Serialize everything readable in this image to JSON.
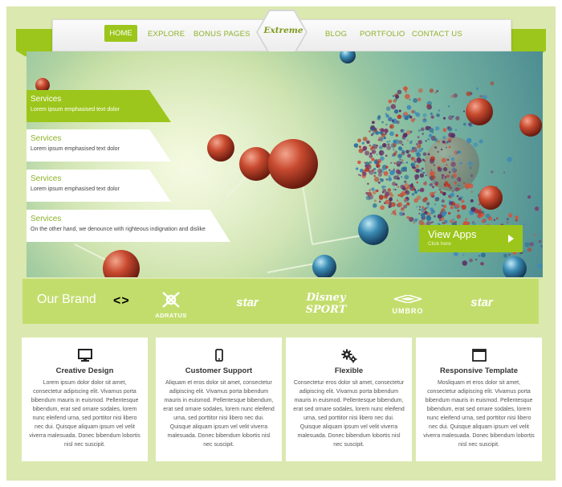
{
  "nav": {
    "home": "HOME",
    "items": [
      "EXPLORE",
      "BONUS PAGES",
      "BLOG",
      "PORTFOLIO",
      "CONTACT US"
    ],
    "logo": "Extreme"
  },
  "hero": {
    "tabs": [
      {
        "title": "Services",
        "text": "Lorem ipsum emphasised text dolor",
        "active": true
      },
      {
        "title": "Services",
        "text": "Lorem ipsum emphasised text dolor",
        "active": false
      },
      {
        "title": "Services",
        "text": "Lorem ipsum emphasised text dolor",
        "active": false
      },
      {
        "title": "Services",
        "text": "On the other hand, we denounce with righteous indignation and dislike",
        "active": false
      }
    ],
    "cta_title": "View Apps",
    "cta_sub": "Click here"
  },
  "brand": {
    "label": "Our Brand",
    "nav": "<>",
    "logos": [
      "ADRATUS",
      "star",
      "Disney SPORT",
      "UMBRO",
      "star"
    ]
  },
  "cards": [
    {
      "title": "Creative Design",
      "icon": "monitor-icon",
      "text": "Lorem ipsum dolor dolor sit amet, consectetur adipiscing elit. Vivamus porta bibendum mauris in euismod. Pellentesque bibendum, erat sed ornare sodales, lorem nunc eleifend urna, sed porttitor nisi libero nec dui. Quisque aliquam ipsum vel velit viverra malesuada. Donec bibendum lobortis nisl nec suscipit."
    },
    {
      "title": "Customer Support",
      "icon": "phone-icon",
      "text": "Aliquam et eros dolor sit amet, consectetur adipiscing elit. Vivamus porta bibendum mauris in euismod. Pellentesque bibendum, erat sed ornare sodales, lorem nunc eleifend urna, sed porttitor nisi libero nec dui. Quisque aliquam ipsum vel velit viverra malesuada. Donec bibendum lobortis nisl nec suscipit."
    },
    {
      "title": "Flexible",
      "icon": "gears-icon",
      "text": "Consectetur eros dolor sit amet, consectetur adipiscing elit. Vivamus porta bibendum mauris in euismod. Pellentesque bibendum, erat sed ornare sodales, lorem nunc eleifend urna, sed porttitor nisi libero nec dui. Quisque aliquam ipsum vel velit viverra malesuada. Donec bibendum lobortis nisl nec suscipit."
    },
    {
      "title": "Responsive Template",
      "icon": "window-icon",
      "text": "Mosliquam et eros dolor sit amet, consectetur adipiscing elit. Vivamus porta bibendum mauris in euismod. Pellentesque bibendum, erat sed ornare sodales, lorem nunc eleifend urna, sed porttitor nisi libero nec dui. Quisque aliquam ipsum vel velit viverra malesuada. Donec bibendum lobortis nisl nec suscipit."
    }
  ],
  "colors": {
    "accent": "#9cc61b",
    "page_bg": "#dbe8b0",
    "brand_bar": "#c3dd6c",
    "nav_text": "#8db22a"
  }
}
